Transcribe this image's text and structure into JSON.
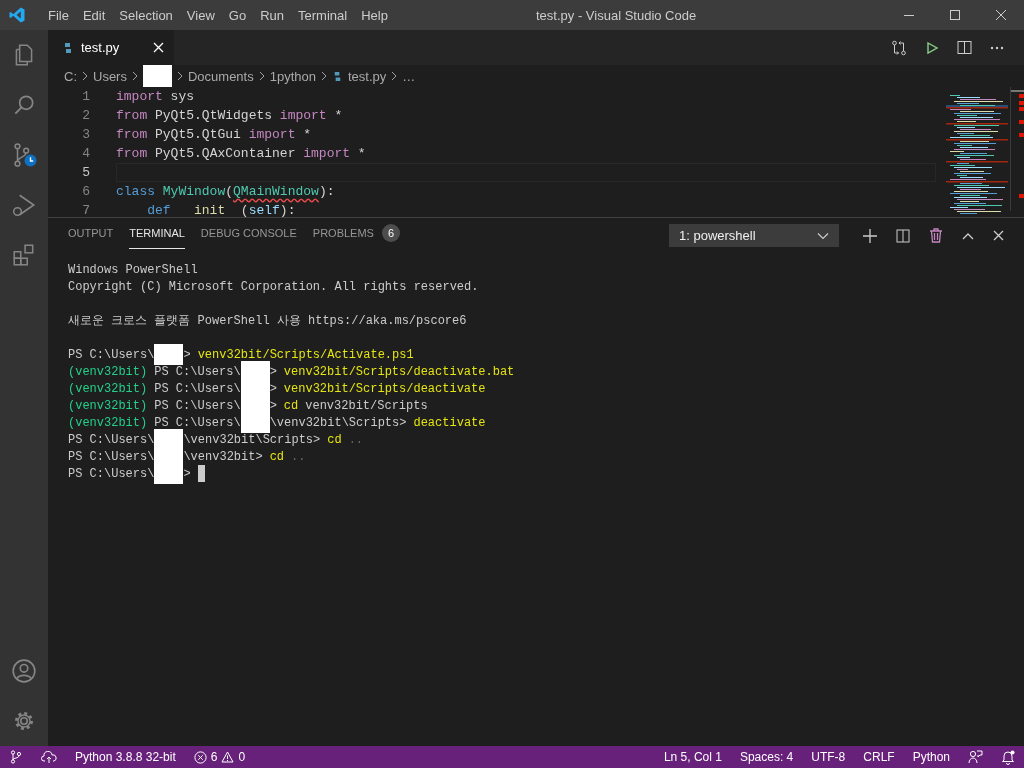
{
  "title_bar": {
    "menus": [
      "File",
      "Edit",
      "Selection",
      "View",
      "Go",
      "Run",
      "Terminal",
      "Help"
    ],
    "title": "test.py - Visual Studio Code"
  },
  "editor": {
    "tabs": [
      {
        "label": "test.py",
        "selected": true
      }
    ],
    "breadcrumbs": [
      {
        "kind": "text",
        "label": "C:"
      },
      {
        "kind": "text",
        "label": "Users"
      },
      {
        "kind": "redacted"
      },
      {
        "kind": "text",
        "label": "Documents"
      },
      {
        "kind": "text",
        "label": "1python"
      },
      {
        "kind": "file",
        "label": "test.py"
      },
      {
        "kind": "text",
        "label": "…"
      }
    ],
    "lines": [
      {
        "number": "1",
        "current": false,
        "tokens": [
          {
            "kind": "keyword",
            "text": "import"
          },
          {
            "kind": "plain",
            "text": " sys"
          }
        ]
      },
      {
        "number": "2",
        "current": false,
        "tokens": [
          {
            "kind": "keyword",
            "text": "from"
          },
          {
            "kind": "plain",
            "text": " PyQt5.QtWidgets "
          },
          {
            "kind": "keyword",
            "text": "import"
          },
          {
            "kind": "plain",
            "text": " *"
          }
        ]
      },
      {
        "number": "3",
        "current": false,
        "tokens": [
          {
            "kind": "keyword",
            "text": "from"
          },
          {
            "kind": "plain",
            "text": " PyQt5.QtGui "
          },
          {
            "kind": "keyword",
            "text": "import"
          },
          {
            "kind": "plain",
            "text": " *"
          }
        ]
      },
      {
        "number": "4",
        "current": false,
        "tokens": [
          {
            "kind": "keyword",
            "text": "from"
          },
          {
            "kind": "plain",
            "text": " PyQt5.QAxContainer "
          },
          {
            "kind": "keyword",
            "text": "import"
          },
          {
            "kind": "plain",
            "text": " *"
          }
        ]
      },
      {
        "number": "5",
        "current": true
      },
      {
        "number": "6",
        "current": false,
        "tokens": [
          {
            "kind": "storage",
            "text": "class"
          },
          {
            "kind": "type",
            "text": " MyWindow"
          },
          {
            "kind": "plain",
            "text": "("
          },
          {
            "kind": "type_error",
            "text": "QMainWindow"
          },
          {
            "kind": "plain",
            "text": "):"
          }
        ]
      },
      {
        "number": "7",
        "current": false,
        "tokens": [
          {
            "kind": "storage",
            "text": "    def"
          },
          {
            "kind": "function",
            "text": "   init  "
          },
          {
            "kind": "plain",
            "text": "("
          },
          {
            "kind": "param",
            "text": "self"
          },
          {
            "kind": "plain",
            "text": "):"
          }
        ]
      }
    ]
  },
  "panel": {
    "tabs": [
      {
        "label": "OUTPUT",
        "selected": false
      },
      {
        "label": "TERMINAL",
        "selected": true
      },
      {
        "label": "DEBUG CONSOLE",
        "selected": false
      },
      {
        "label": "PROBLEMS",
        "selected": false,
        "badge": "6"
      }
    ],
    "terminal_selector": "1: powershell",
    "terminal": [
      {
        "kind": "text",
        "segments": [
          {
            "kind": "text",
            "text": "Windows PowerShell"
          }
        ]
      },
      {
        "kind": "text",
        "segments": [
          {
            "kind": "text",
            "text": "Copyright (C) Microsoft Corporation. All rights reserved."
          }
        ]
      },
      {
        "kind": "blank"
      },
      {
        "kind": "text",
        "segments": [
          {
            "kind": "text",
            "text": "새로운 크로스 플랫폼 PowerShell 사용 https://aka.ms/pscore6"
          }
        ]
      },
      {
        "kind": "blank"
      },
      {
        "kind": "text",
        "segments": [
          {
            "kind": "text",
            "text": "PS C:\\Users\\"
          },
          {
            "kind": "redacted"
          },
          {
            "kind": "text",
            "text": ">"
          },
          {
            "kind": "command",
            "text": "venv32bit/Scripts/Activate.ps1"
          }
        ]
      },
      {
        "kind": "text",
        "segments": [
          {
            "kind": "venv",
            "text": "(venv32bit)"
          },
          {
            "kind": "text",
            "text": "PS C:\\Users\\"
          },
          {
            "kind": "redacted"
          },
          {
            "kind": "text",
            "text": ">"
          },
          {
            "kind": "command",
            "text": "venv32bit/Scripts/deactivate.bat"
          }
        ]
      },
      {
        "kind": "text",
        "segments": [
          {
            "kind": "venv",
            "text": "(venv32bit)"
          },
          {
            "kind": "text",
            "text": "PS C:\\Users\\"
          },
          {
            "kind": "redacted"
          },
          {
            "kind": "text",
            "text": ">"
          },
          {
            "kind": "command",
            "text": "venv32bit/Scripts/deactivate"
          }
        ]
      },
      {
        "kind": "text",
        "segments": [
          {
            "kind": "venv",
            "text": "(venv32bit)"
          },
          {
            "kind": "text",
            "text": "PS C:\\Users\\"
          },
          {
            "kind": "redacted"
          },
          {
            "kind": "text",
            "text": ">"
          },
          {
            "kind": "command",
            "text": "cd"
          },
          {
            "kind": "text",
            "text": "venv32bit/Scripts"
          }
        ]
      },
      {
        "kind": "text",
        "segments": [
          {
            "kind": "venv",
            "text": "(venv32bit)"
          },
          {
            "kind": "text",
            "text": "PS C:\\Users\\"
          },
          {
            "kind": "redacted"
          },
          {
            "kind": "text",
            "text": "\\venv32bit\\Scripts>"
          },
          {
            "kind": "command",
            "text": "deactivate"
          }
        ]
      },
      {
        "kind": "text",
        "segments": [
          {
            "kind": "text",
            "text": "PS C:\\Users\\"
          },
          {
            "kind": "redacted"
          },
          {
            "kind": "text",
            "text": "\\venv32bit\\Scripts>"
          },
          {
            "kind": "command",
            "text": "cd"
          },
          {
            "kind": "argument",
            "text": ".."
          }
        ]
      },
      {
        "kind": "text",
        "segments": [
          {
            "kind": "text",
            "text": "PS C:\\Users\\"
          },
          {
            "kind": "redacted"
          },
          {
            "kind": "text",
            "text": "\\venv32bit>"
          },
          {
            "kind": "command",
            "text": "cd"
          },
          {
            "kind": "argument",
            "text": ".."
          }
        ]
      },
      {
        "kind": "text",
        "segments": [
          {
            "kind": "text",
            "text": "PS C:\\Users\\"
          },
          {
            "kind": "redacted"
          },
          {
            "kind": "text",
            "text": ">"
          },
          {
            "kind": "cursor"
          }
        ]
      }
    ]
  },
  "status_bar": {
    "left": [
      {
        "kind": "branch"
      },
      {
        "kind": "sync"
      },
      {
        "kind": "text",
        "label": "Python 3.8.8 32-bit"
      },
      {
        "kind": "problems",
        "errors": "6",
        "warnings": "0"
      }
    ],
    "right": [
      {
        "kind": "text",
        "label": "Ln 5, Col 1"
      },
      {
        "kind": "text",
        "label": "Spaces: 4"
      },
      {
        "kind": "text",
        "label": "UTF-8"
      },
      {
        "kind": "text",
        "label": "CRLF"
      },
      {
        "kind": "text",
        "label": "Python"
      },
      {
        "kind": "feedback"
      },
      {
        "kind": "bell"
      }
    ]
  }
}
